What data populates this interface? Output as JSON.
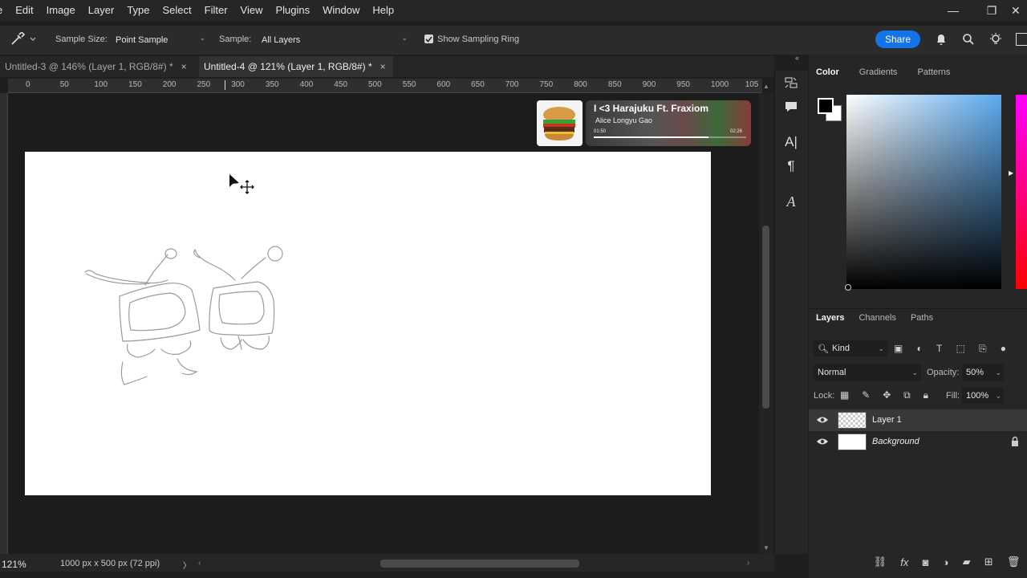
{
  "menu": [
    "e",
    "Edit",
    "Image",
    "Layer",
    "Type",
    "Select",
    "Filter",
    "View",
    "Plugins",
    "Window",
    "Help"
  ],
  "options": {
    "sample_size_label": "Sample Size:",
    "sample_size_value": "Point Sample",
    "sample_label": "Sample:",
    "sample_value": "All Layers",
    "show_ring_label": "Show Sampling Ring",
    "share_label": "Share"
  },
  "tabs": [
    {
      "label": "Untitled-3 @ 146% (Layer 1, RGB/8#) *",
      "close": "×"
    },
    {
      "label": "Untitled-4 @ 121% (Layer 1, RGB/8#) *",
      "close": "×"
    }
  ],
  "ruler_ticks": [
    "0",
    "50",
    "100",
    "150",
    "200",
    "250",
    "300",
    "350",
    "400",
    "450",
    "500",
    "550",
    "600",
    "650",
    "700",
    "750",
    "800",
    "850",
    "900",
    "950",
    "1000",
    "105"
  ],
  "media": {
    "title": "I <3 Harajuku Ft. Fraxiom",
    "artist": "Alice Longyu Gao",
    "elapsed": "01:50",
    "duration": "02:26",
    "progress": 0.75
  },
  "status": {
    "zoom": "121%",
    "doc_info": "1000 px x 500 px (72 ppi)",
    "arrow": "〉"
  },
  "color_panel": {
    "tabs": [
      "Color",
      "Gradients",
      "Patterns"
    ],
    "foreground": "#000000",
    "background": "#ffffff"
  },
  "layers_panel": {
    "tabs": [
      "Layers",
      "Channels",
      "Paths"
    ],
    "filter_label": "Kind",
    "blend_mode": "Normal",
    "opacity_label": "Opacity:",
    "opacity_value": "50%",
    "lock_label": "Lock:",
    "fill_label": "Fill:",
    "fill_value": "100%",
    "layers": [
      {
        "name": "Layer 1",
        "selected": true,
        "visible": true,
        "locked": false
      },
      {
        "name": "Background",
        "selected": false,
        "visible": true,
        "locked": true
      }
    ]
  },
  "colors": {
    "accent": "#1473e6",
    "ui_bg": "#262626",
    "canvas": "#ffffff"
  }
}
